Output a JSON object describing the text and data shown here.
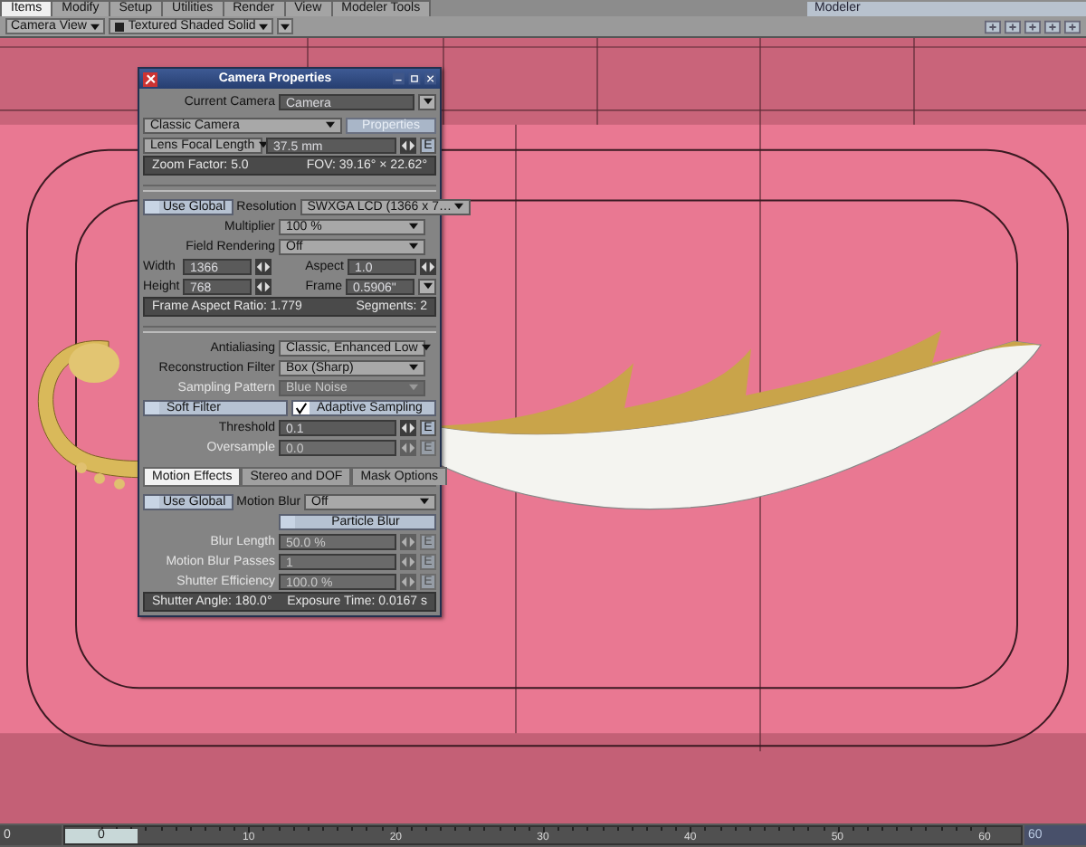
{
  "tabs": [
    {
      "label": "Items",
      "selected": true
    },
    {
      "label": "Modify",
      "selected": false
    },
    {
      "label": "Setup",
      "selected": false
    },
    {
      "label": "Utilities",
      "selected": false
    },
    {
      "label": "Render",
      "selected": false
    },
    {
      "label": "View",
      "selected": false
    },
    {
      "label": "Modeler Tools",
      "selected": false
    }
  ],
  "mode_selector": "Modeler",
  "viewport_toolbar": {
    "view": "Camera View",
    "shading": "Textured Shaded Solid"
  },
  "camera_panel": {
    "title": "Camera Properties",
    "rows": [
      {
        "kind": "combo",
        "label": "Current Camera",
        "value": "Camera"
      },
      {
        "kind": "typebar",
        "value": "Classic Camera",
        "button": "Properties",
        "disabled": true
      },
      {
        "kind": "lens",
        "mode": "Lens Focal Length",
        "value": "37.5 mm",
        "envelope": "E"
      },
      {
        "kind": "info",
        "texts": [
          "Zoom Factor: 5.0",
          "FOV: 39.16° × 22.62°"
        ]
      },
      {
        "kind": "divider"
      },
      {
        "kind": "select",
        "toggle": {
          "label": "Use Global",
          "checked": false
        },
        "label": "Resolution",
        "value": "SWXGA LCD (1366 x 7…",
        "disabled": false
      },
      {
        "kind": "select",
        "label": "Multiplier",
        "value": "100 %",
        "disabled": false
      },
      {
        "kind": "select",
        "label": "Field Rendering",
        "value": "Off",
        "disabled": false
      },
      {
        "kind": "pair",
        "left": {
          "label": "Width",
          "value": "1366"
        },
        "right": {
          "label": "Aspect",
          "value": "1.0",
          "dropdown": false
        }
      },
      {
        "kind": "pair",
        "left": {
          "label": "Height",
          "value": "768"
        },
        "right": {
          "label": "Frame",
          "value": "0.5906\"",
          "dropdown": true
        }
      },
      {
        "kind": "info",
        "texts": [
          "Frame Aspect Ratio: 1.779",
          "Segments: 2"
        ]
      },
      {
        "kind": "divider"
      },
      {
        "kind": "select",
        "label": "Antialiasing",
        "value": "Classic, Enhanced Low",
        "disabled": false
      },
      {
        "kind": "select",
        "label": "Reconstruction Filter",
        "value": "Box (Sharp)",
        "disabled": false
      },
      {
        "kind": "select",
        "label": "Sampling Pattern",
        "value": "Blue Noise",
        "disabled": true
      },
      {
        "kind": "checks",
        "items": [
          {
            "label": "Soft Filter",
            "checked": false
          },
          {
            "label": "Adaptive Sampling",
            "checked": true
          }
        ]
      },
      {
        "kind": "number",
        "label": "Threshold",
        "value": "0.1",
        "envelope": "E",
        "disabled": false
      },
      {
        "kind": "number",
        "label": "Oversample",
        "value": "0.0",
        "envelope": "E",
        "disabled": true
      },
      {
        "kind": "tabs",
        "items": [
          {
            "label": "Motion Effects",
            "selected": true
          },
          {
            "label": "Stereo and DOF",
            "selected": false
          },
          {
            "label": "Mask Options",
            "selected": false
          }
        ]
      },
      {
        "kind": "select",
        "toggle": {
          "label": "Use Global",
          "checked": false
        },
        "label": "Motion Blur",
        "value": "Off",
        "disabled": false
      },
      {
        "kind": "toggle",
        "label": "Particle Blur",
        "checked": false
      },
      {
        "kind": "number",
        "label": "Blur Length",
        "value": "50.0 %",
        "envelope": "E",
        "disabled": true
      },
      {
        "kind": "number",
        "label": "Motion Blur Passes",
        "value": "1",
        "envelope": "E",
        "disabled": true
      },
      {
        "kind": "number",
        "label": "Shutter Efficiency",
        "value": "100.0 %",
        "envelope": "E",
        "disabled": true
      },
      {
        "kind": "info",
        "texts": [
          "Shutter Angle: 180.0°",
          "Exposure Time: 0.0167 s"
        ]
      }
    ]
  },
  "timeline": {
    "start": "0",
    "end": "60",
    "current": "0",
    "labels": [
      "10",
      "20",
      "30",
      "40",
      "50",
      "60"
    ]
  }
}
